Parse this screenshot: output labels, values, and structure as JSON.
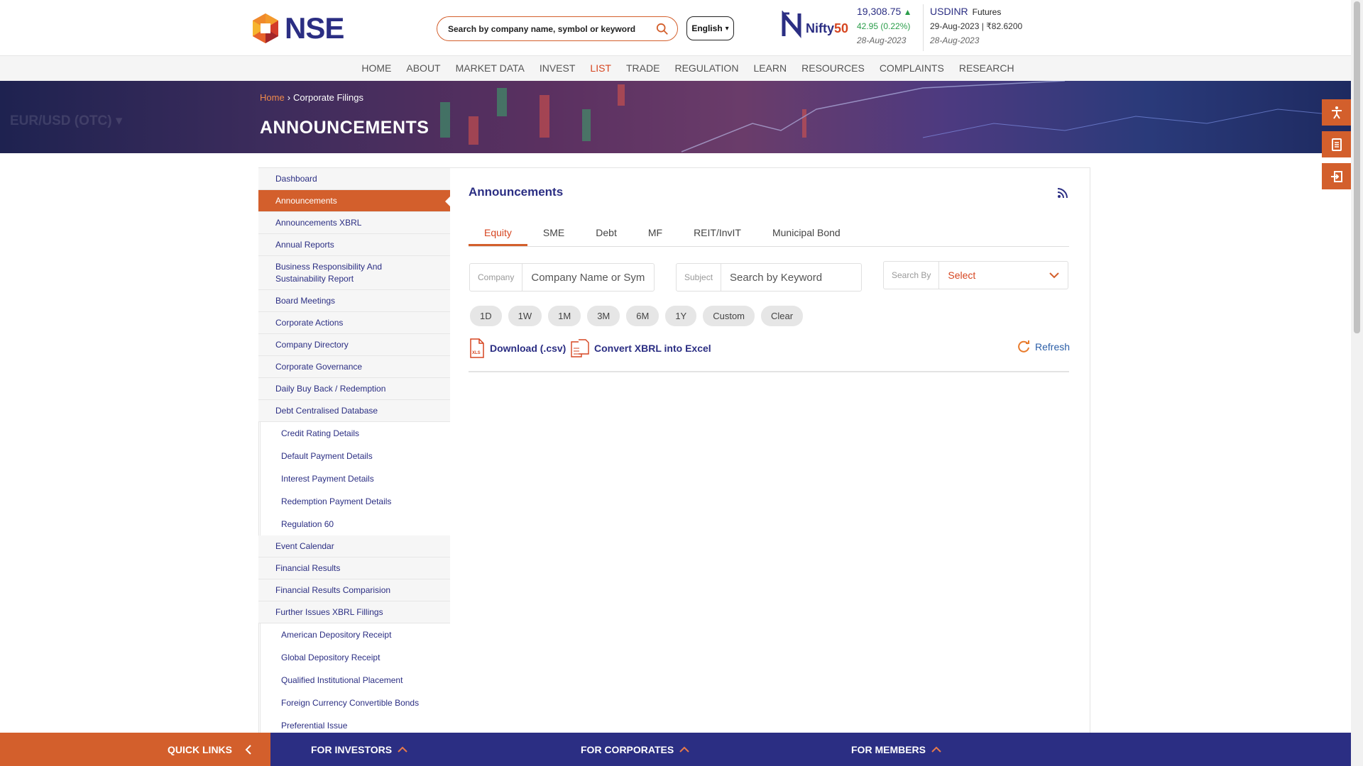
{
  "header": {
    "logo_text": "NSE",
    "search_placeholder": "Search by company name, symbol or keyword",
    "language": "English",
    "nifty": {
      "brand": "Nifty",
      "brand_suffix": "50",
      "value": "19,308.75",
      "change": "42.95 (0.22%)",
      "date": "28-Aug-2023"
    },
    "usdinr": {
      "symbol": "USDINR",
      "type": "Futures",
      "line": "29-Aug-2023 | ₹82.6200",
      "date": "28-Aug-2023"
    }
  },
  "nav": [
    "HOME",
    "ABOUT",
    "MARKET DATA",
    "INVEST",
    "LIST",
    "TRADE",
    "REGULATION",
    "LEARN",
    "RESOURCES",
    "COMPLAINTS",
    "RESEARCH"
  ],
  "banner": {
    "breadcrumb_home": "Home",
    "breadcrumb_current": "Corporate Filings",
    "title": "ANNOUNCEMENTS",
    "ghost_text": "EUR/USD (OTC) ▾"
  },
  "sidebar": {
    "items": [
      {
        "label": "Dashboard"
      },
      {
        "label": "Announcements",
        "active": true
      },
      {
        "label": "Announcements XBRL"
      },
      {
        "label": "Annual Reports"
      },
      {
        "label": "Business Responsibility And Sustainability Report",
        "tall": true
      },
      {
        "label": "Board Meetings"
      },
      {
        "label": "Corporate Actions"
      },
      {
        "label": "Company Directory"
      },
      {
        "label": "Corporate Governance"
      },
      {
        "label": "Daily Buy Back / Redemption"
      },
      {
        "label": "Debt Centralised Database"
      },
      {
        "label": "Credit Rating Details",
        "sub": true
      },
      {
        "label": "Default Payment Details",
        "sub": true
      },
      {
        "label": "Interest Payment Details",
        "sub": true
      },
      {
        "label": "Redemption Payment Details",
        "sub": true
      },
      {
        "label": "Regulation 60",
        "sub": true
      },
      {
        "label": "Event Calendar"
      },
      {
        "label": "Financial Results"
      },
      {
        "label": "Financial Results Comparision"
      },
      {
        "label": "Further Issues XBRL Fillings"
      },
      {
        "label": "American Depository Receipt",
        "sub": true
      },
      {
        "label": "Global Depository Receipt",
        "sub": true
      },
      {
        "label": "Qualified Institutional Placement",
        "sub": true
      },
      {
        "label": "Foreign Currency Convertible Bonds",
        "sub": true
      },
      {
        "label": "Preferential Issue",
        "sub": true
      }
    ]
  },
  "main": {
    "title": "Announcements",
    "tabs": [
      "Equity",
      "SME",
      "Debt",
      "MF",
      "REIT/InvIT",
      "Municipal Bond"
    ],
    "company_label": "Company",
    "company_placeholder": "Company Name or Symbol",
    "subject_label": "Subject",
    "subject_placeholder": "Search by Keyword",
    "searchby_label": "Search By",
    "searchby_value": "Select",
    "periods": [
      "1D",
      "1W",
      "1M",
      "3M",
      "6M",
      "1Y",
      "Custom",
      "Clear"
    ],
    "download_label": "Download (.csv)",
    "convert_label": "Convert XBRL into Excel",
    "refresh_label": "Refresh"
  },
  "footer": {
    "quick_links": "QUICK LINKS",
    "investors": "FOR INVESTORS",
    "corporates": "FOR CORPORATES",
    "members": "FOR MEMBERS"
  },
  "colors": {
    "accent": "#d35f2c",
    "brand_blue": "#2b2e83",
    "up_green": "#2a9d4a"
  }
}
